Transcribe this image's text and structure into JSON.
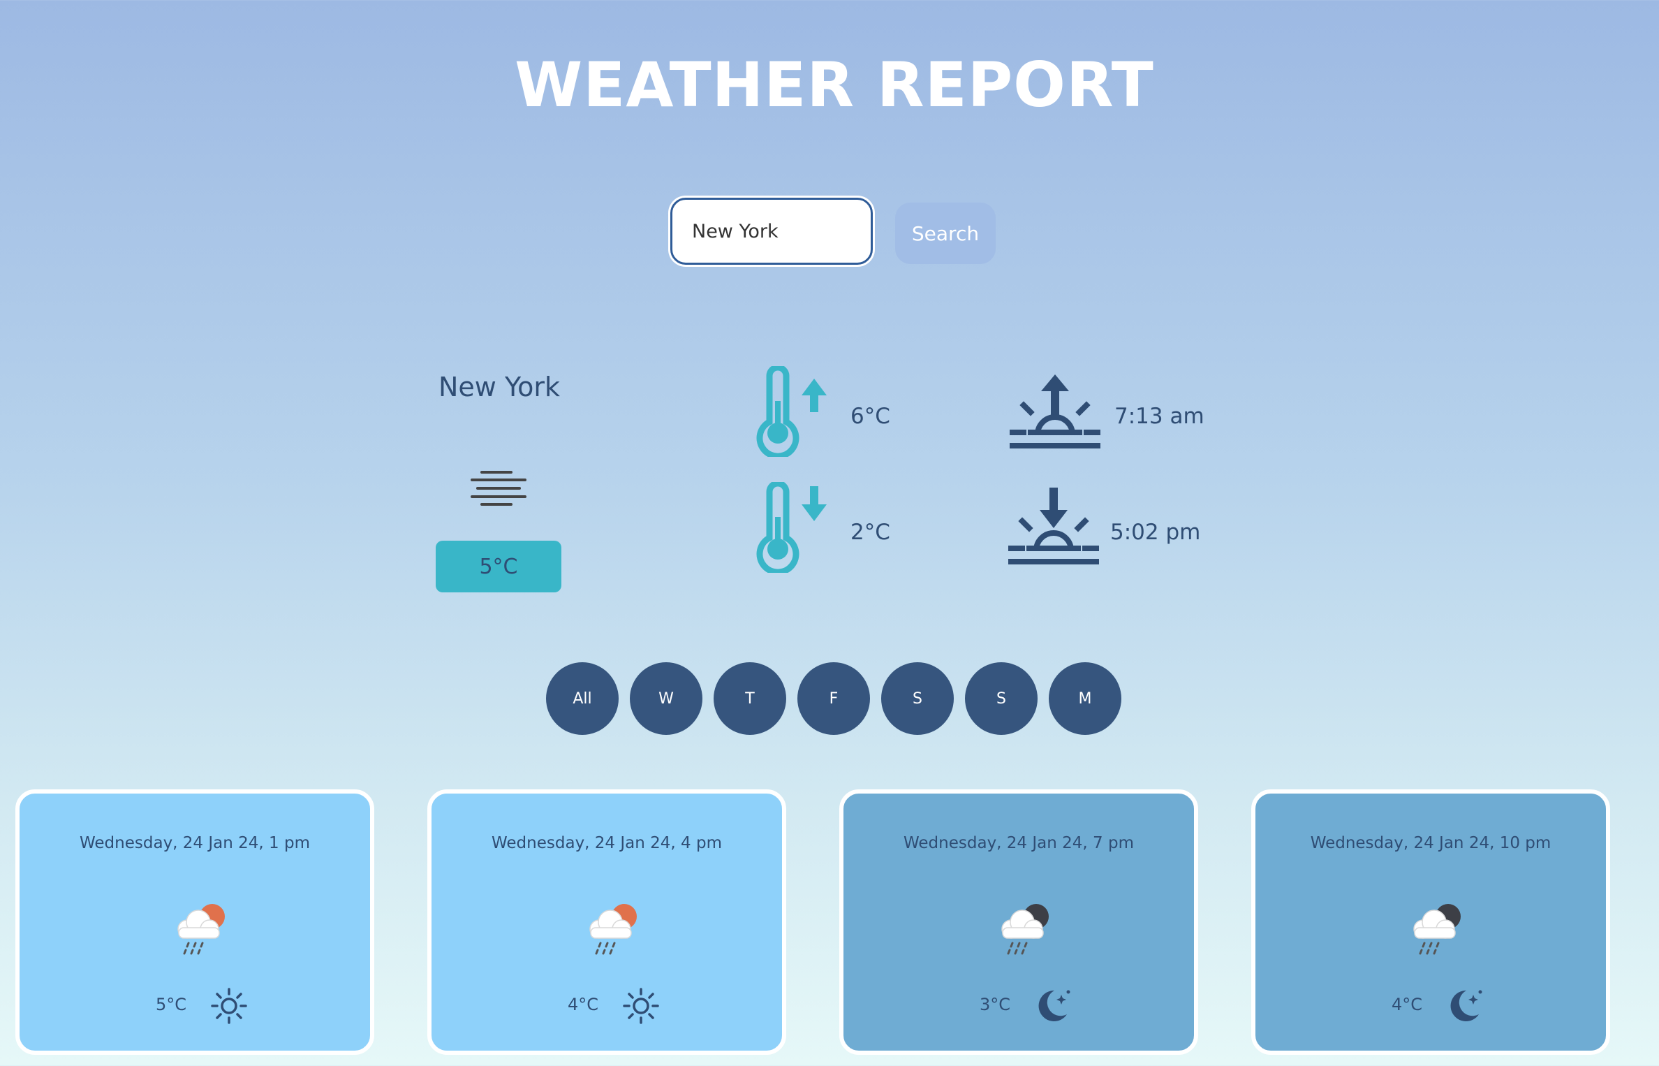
{
  "header": {
    "title": "WEATHER REPORT"
  },
  "search": {
    "value": "New York",
    "button_label": "Search"
  },
  "current": {
    "city": "New York",
    "condition_icon": "mist-icon",
    "temperature": "5°C",
    "max_temp": "6°C",
    "min_temp": "2°C",
    "sunrise": "7:13 am",
    "sunset": "5:02 pm"
  },
  "day_filters": [
    "All",
    "W",
    "T",
    "F",
    "S",
    "S",
    "M"
  ],
  "forecast": [
    {
      "date": "Wednesday, 24 Jan 24, 1 pm",
      "temp": "5°C",
      "weather_icon": "rain-cloud-sun-icon",
      "time_of_day_icon": "sun-icon"
    },
    {
      "date": "Wednesday, 24 Jan 24, 4 pm",
      "temp": "4°C",
      "weather_icon": "rain-cloud-sun-icon",
      "time_of_day_icon": "sun-icon"
    },
    {
      "date": "Wednesday, 24 Jan 24, 7 pm",
      "temp": "3°C",
      "weather_icon": "rain-cloud-moon-icon",
      "time_of_day_icon": "moon-icon"
    },
    {
      "date": "Wednesday, 24 Jan 24, 10 pm",
      "temp": "4°C",
      "weather_icon": "rain-cloud-moon-icon",
      "time_of_day_icon": "moon-icon"
    }
  ],
  "colors": {
    "accent": "#39b6c8",
    "dark": "#36557e",
    "day_card": "#8ed1fa",
    "night_card": "#6facd3"
  }
}
